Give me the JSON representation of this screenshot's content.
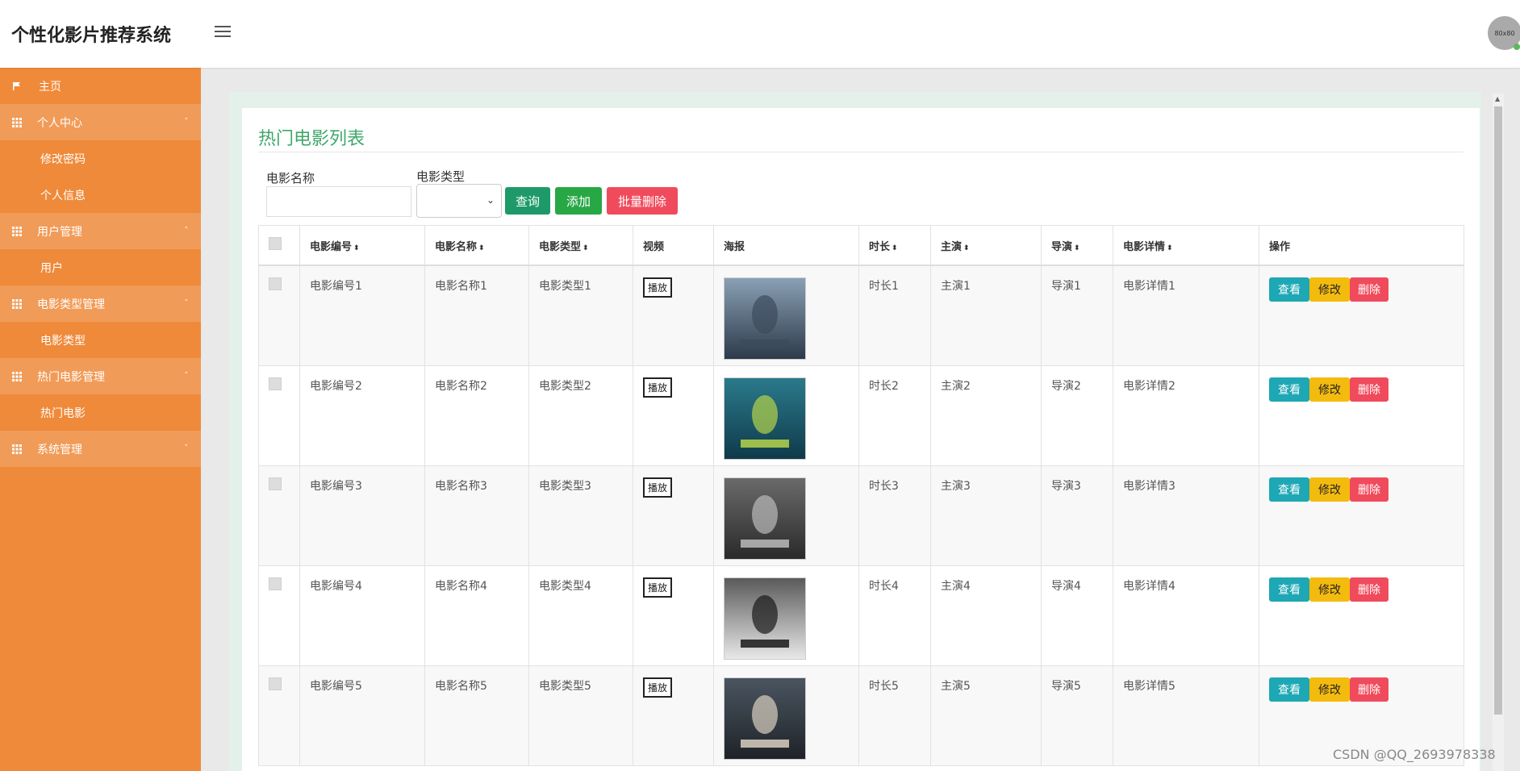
{
  "app": {
    "title": "个性化影片推荐系统",
    "avatar_text": "80x80"
  },
  "sidebar": {
    "home": "主页",
    "items": [
      {
        "label": "个人中心",
        "type": "group",
        "caret": "˄"
      },
      {
        "label": "修改密码",
        "type": "sub"
      },
      {
        "label": "个人信息",
        "type": "sub"
      },
      {
        "label": "用户管理",
        "type": "group",
        "caret": "˄"
      },
      {
        "label": "用户",
        "type": "sub"
      },
      {
        "label": "电影类型管理",
        "type": "group",
        "caret": "˄"
      },
      {
        "label": "电影类型",
        "type": "sub"
      },
      {
        "label": "热门电影管理",
        "type": "group",
        "caret": "˄"
      },
      {
        "label": "热门电影",
        "type": "sub"
      },
      {
        "label": "系统管理",
        "type": "group",
        "caret": "˅"
      }
    ]
  },
  "main": {
    "title": "热门电影列表",
    "search": {
      "name_label": "电影名称",
      "name_value": "",
      "type_label": "电影类型",
      "type_value": ""
    },
    "buttons": {
      "query": "查询",
      "add": "添加",
      "batch_delete": "批量删除"
    },
    "table": {
      "headers": [
        "电影编号",
        "电影名称",
        "电影类型",
        "视频",
        "海报",
        "时长",
        "主演",
        "导演",
        "电影详情",
        "操作"
      ],
      "play_label": "播放",
      "actions": {
        "view": "查看",
        "edit": "修改",
        "delete": "删除"
      },
      "rows": [
        {
          "id": "电影编号1",
          "name": "电影名称1",
          "type": "电影类型1",
          "duration": "时长1",
          "actor": "主演1",
          "director": "导演1",
          "detail": "电影详情1"
        },
        {
          "id": "电影编号2",
          "name": "电影名称2",
          "type": "电影类型2",
          "duration": "时长2",
          "actor": "主演2",
          "director": "导演2",
          "detail": "电影详情2"
        },
        {
          "id": "电影编号3",
          "name": "电影名称3",
          "type": "电影类型3",
          "duration": "时长3",
          "actor": "主演3",
          "director": "导演3",
          "detail": "电影详情3"
        },
        {
          "id": "电影编号4",
          "name": "电影名称4",
          "type": "电影类型4",
          "duration": "时长4",
          "actor": "主演4",
          "director": "导演4",
          "detail": "电影详情4"
        },
        {
          "id": "电影编号5",
          "name": "电影名称5",
          "type": "电影类型5",
          "duration": "时长5",
          "actor": "主演5",
          "director": "导演5",
          "detail": "电影详情5"
        }
      ]
    }
  },
  "watermark": "CSDN @QQ_2693978338",
  "colors": {
    "sidebar": "#ef8a3a",
    "sidebar_group": "#f19b58",
    "title_green": "#3fa86a",
    "query": "#1e9a6a",
    "add": "#28a745",
    "batch_delete": "#f04b5c",
    "view": "#1ea7b4",
    "edit": "#f4bb0f",
    "delete": "#f04b5c"
  }
}
